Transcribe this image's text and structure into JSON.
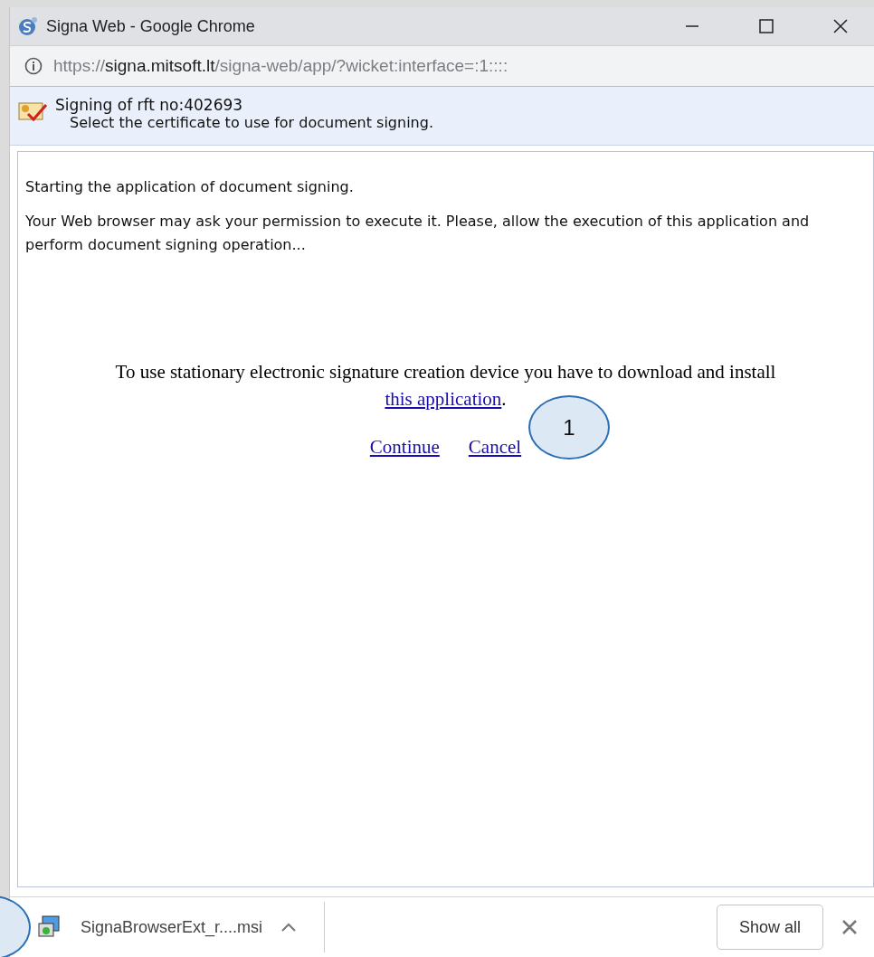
{
  "window": {
    "title": "Signa Web - Google Chrome"
  },
  "address_bar": {
    "scheme": "https://",
    "host": "signa.mitsoft.lt",
    "path": "/signa-web/app/?wicket:interface=:1::::"
  },
  "header": {
    "title": "Signing of rft no:402693",
    "subtitle": "Select the certificate to use for document signing."
  },
  "messages": [
    "Starting the application of document signing.",
    "Your Web browser may ask your permission to execute it. Please, allow the execution of this application and perform document signing operation..."
  ],
  "notice": {
    "before": "To use stationary electronic signature creation device you have to download and install",
    "link": "this application",
    "after": "."
  },
  "actions": [
    "Continue",
    "Cancel"
  ],
  "callout": {
    "label": "1"
  },
  "download_bar": {
    "file": "SignaBrowserExt_r....msi",
    "show_all": "Show all"
  }
}
